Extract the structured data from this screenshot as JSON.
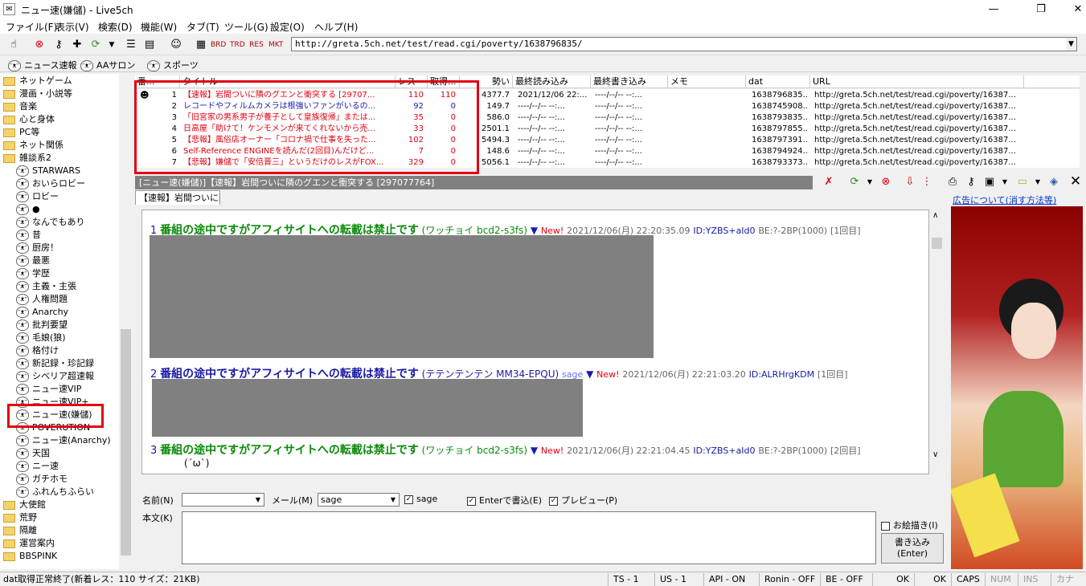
{
  "window": {
    "title": "ニュー速(嫌儲) - Live5ch",
    "minimize": "—",
    "maximize": "❐",
    "close": "✕"
  },
  "menu": [
    "ファイル(F)",
    "表示(V)",
    "検索(D)",
    "機能(W)",
    "タブ(T)",
    "ツール(G)",
    "設定(O)",
    "ヘルプ(H)"
  ],
  "address": {
    "url": "http://greta.5ch.net/test/read.cgi/poverty/1638796835/"
  },
  "linkbar": [
    "ニュース速報",
    "AAサロン",
    "スポーツ"
  ],
  "tree": {
    "items": [
      {
        "label": "ネットゲーム",
        "type": "folder"
      },
      {
        "label": "漫画・小説等",
        "type": "folder"
      },
      {
        "label": "音楽",
        "type": "folder"
      },
      {
        "label": "心と身体",
        "type": "folder"
      },
      {
        "label": "PC等",
        "type": "folder"
      },
      {
        "label": "ネット関係",
        "type": "folder"
      },
      {
        "label": "雑談系2",
        "type": "folder"
      },
      {
        "label": "STARWARS",
        "type": "board"
      },
      {
        "label": "おいらロビー",
        "type": "board"
      },
      {
        "label": "ロビー",
        "type": "board"
      },
      {
        "label": "●",
        "type": "board"
      },
      {
        "label": "なんでもあり",
        "type": "board"
      },
      {
        "label": "昔",
        "type": "board"
      },
      {
        "label": "厨房！",
        "type": "board"
      },
      {
        "label": "最悪",
        "type": "board"
      },
      {
        "label": "学歴",
        "type": "board"
      },
      {
        "label": "主義・主張",
        "type": "board"
      },
      {
        "label": "人権問題",
        "type": "board"
      },
      {
        "label": "Anarchy",
        "type": "board"
      },
      {
        "label": "批判要望",
        "type": "board"
      },
      {
        "label": "毛娘(狼)",
        "type": "board"
      },
      {
        "label": "格付け",
        "type": "board"
      },
      {
        "label": "新記録・珍記録",
        "type": "board"
      },
      {
        "label": "シベリア超速報",
        "type": "board"
      },
      {
        "label": "ニュー速VIP",
        "type": "board"
      },
      {
        "label": "ニュー速VIP+",
        "type": "board"
      },
      {
        "label": "ニュー速(嫌儲)",
        "type": "board"
      },
      {
        "label": "POVERUTION",
        "type": "board"
      },
      {
        "label": "ニュー速(Anarchy)",
        "type": "board"
      },
      {
        "label": "天国",
        "type": "board"
      },
      {
        "label": "ニー速",
        "type": "board"
      },
      {
        "label": "ガチホモ",
        "type": "board"
      },
      {
        "label": "ふれんちふらい",
        "type": "board"
      },
      {
        "label": "大使館",
        "type": "folder"
      },
      {
        "label": "荒野",
        "type": "folder"
      },
      {
        "label": "隔離",
        "type": "folder"
      },
      {
        "label": "運営案内",
        "type": "folder"
      },
      {
        "label": "BBSPINK",
        "type": "folder"
      }
    ]
  },
  "threadlist": {
    "headers": [
      "番...",
      "タイトル",
      "レス",
      "取得...",
      "勢い",
      "最終読み込み",
      "最終書き込み",
      "メモ",
      "dat",
      "URL"
    ],
    "rows": [
      {
        "num": "1",
        "title": "【速報】岩間ついに隣のグエンと衝突する [29707...",
        "res": "110",
        "got": "110",
        "speed": "4377.7",
        "lastread": "2021/12/06 22:...",
        "lastwrite": "----/--/-- --:...",
        "memo": "",
        "dat": "1638796835...",
        "url": "http://greta.5ch.net/test/read.cgi/poverty/16387...",
        "color": "red"
      },
      {
        "num": "2",
        "title": "レコードやフィルムカメラは根強いファンがいるの...",
        "res": "92",
        "got": "0",
        "speed": "149.7",
        "lastread": "----/--/-- --:...",
        "lastwrite": "----/--/-- --:...",
        "memo": "",
        "dat": "1638745908...",
        "url": "http://greta.5ch.net/test/read.cgi/poverty/16387...",
        "color": "blue"
      },
      {
        "num": "3",
        "title": "「旧宮家の男系男子が養子として皇族復帰」または...",
        "res": "35",
        "got": "0",
        "speed": "586.0",
        "lastread": "----/--/-- --:...",
        "lastwrite": "----/--/-- --:...",
        "memo": "",
        "dat": "1638793835...",
        "url": "http://greta.5ch.net/test/read.cgi/poverty/16387...",
        "color": "red"
      },
      {
        "num": "4",
        "title": "日高屋「助けて！ケンモメンが来てくれないから売...",
        "res": "33",
        "got": "0",
        "speed": "2501.1",
        "lastread": "----/--/-- --:...",
        "lastwrite": "----/--/-- --:...",
        "memo": "",
        "dat": "1638797855...",
        "url": "http://greta.5ch.net/test/read.cgi/poverty/16387...",
        "color": "red"
      },
      {
        "num": "5",
        "title": "【悲報】風俗店オーナー「コロナ禍で仕事を失った...",
        "res": "102",
        "got": "0",
        "speed": "5494.3",
        "lastread": "----/--/-- --:...",
        "lastwrite": "----/--/-- --:...",
        "memo": "",
        "dat": "1638797391...",
        "url": "http://greta.5ch.net/test/read.cgi/poverty/16387...",
        "color": "red"
      },
      {
        "num": "6",
        "title": "Self-Reference ENGINEを読んだ(2回目)んだけど...",
        "res": "7",
        "got": "0",
        "speed": "148.6",
        "lastread": "----/--/-- --:...",
        "lastwrite": "----/--/-- --:...",
        "memo": "",
        "dat": "1638794924...",
        "url": "http://greta.5ch.net/test/read.cgi/poverty/16387...",
        "color": "red"
      },
      {
        "num": "7",
        "title": "【悲報】嫌儲で「安倍晋三」というだけのレスがFOX...",
        "res": "329",
        "got": "0",
        "speed": "5056.1",
        "lastread": "----/--/-- --:...",
        "lastwrite": "----/--/-- --:...",
        "memo": "",
        "dat": "1638793373...",
        "url": "http://greta.5ch.net/test/read.cgi/poverty/16387...",
        "color": "red"
      }
    ]
  },
  "thread": {
    "header": "[ニュー速(嫌儲)]【速報】岩間ついに隣のグエンと衝突する [297077764]",
    "tab": "【速報】岩間ついに隣",
    "ad_link": "広告について(消す方法等)",
    "posts": [
      {
        "num": "1",
        "title": "番組の途中ですがアフィサイトへの転載は禁止です",
        "name": "(ワッチョイ bcd2-s3fs)",
        "mail": "",
        "new": "New!",
        "date": "2021/12/06(月) 22:20:35.09",
        "id": "ID:YZBS+aId0",
        "be": "BE:?-2BP(1000)",
        "count": "[1回目]",
        "color": "green"
      },
      {
        "num": "2",
        "title": "番組の途中ですがアフィサイトへの転載は禁止です",
        "name": "(テテンテンテン MM34-EPQU)",
        "mail": "sage",
        "new": "New!",
        "date": "2021/12/06(月) 22:21:03.20",
        "id": "ID:ALRHrgKDM",
        "be": "",
        "count": "[1回目]",
        "color": "blue"
      },
      {
        "num": "3",
        "title": "番組の途中ですがアフィサイトへの転載は禁止です",
        "name": "(ワッチョイ bcd2-s3fs)",
        "mail": "",
        "new": "New!",
        "date": "2021/12/06(月) 22:21:04.45",
        "id": "ID:YZBS+aId0",
        "be": "BE:?-2BP(1000)",
        "count": "[2回目]",
        "color": "green"
      }
    ],
    "aa": "(´ω`)"
  },
  "form": {
    "name_label": "名前(N)",
    "mail_label": "メール(M)",
    "mail_value": "sage",
    "sage_label": "sage",
    "enter_label": "Enterで書込(E)",
    "preview_label": "プレビュー(P)",
    "body_label": "本文(K)",
    "oekaki_label": "お絵描き(I)",
    "submit_line1": "書き込み",
    "submit_line2": "(Enter)"
  },
  "status": {
    "left": "dat取得正常終了(新着レス：110 サイズ：21KB)",
    "ts": "TS - 1",
    "us": "US - 1",
    "api": "API - ON",
    "ronin": "Ronin - OFF",
    "be": "BE - OFF",
    "ok1": "OK",
    "ok2": "OK",
    "caps": "CAPS",
    "num": "NUM",
    "ins": "INS",
    "kana": "カナ"
  },
  "colors": {
    "highlight": "#e00012",
    "thread_red": "#e00012",
    "thread_blue": "#1a1aa6",
    "post_green": "#0a8a0a",
    "post_blue": "#1a1aa6"
  }
}
